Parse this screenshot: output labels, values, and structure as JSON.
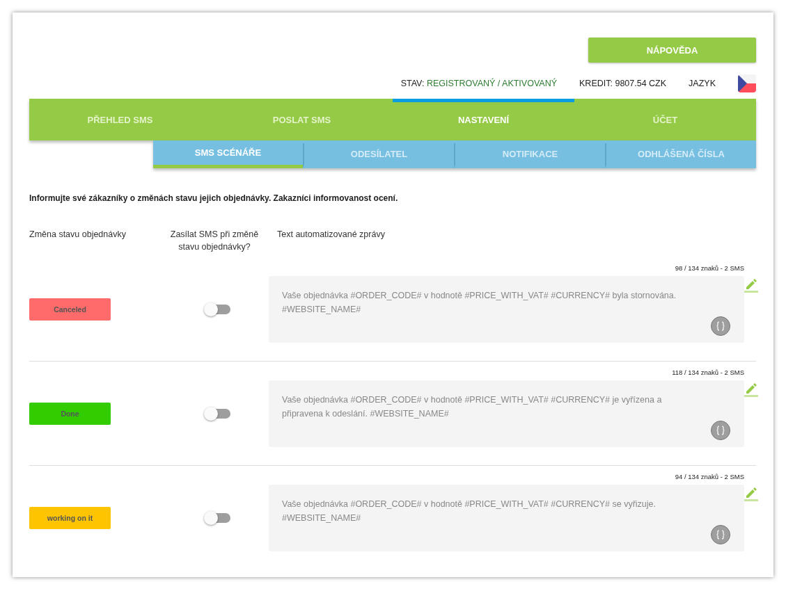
{
  "help_button": "NÁPOVĚDA",
  "status_bar": {
    "state_label": "STAV:",
    "state_value": "REGISTROVANÝ / AKTIVOVANÝ",
    "credit": "KREDIT: 9807.54 CZK",
    "language_label": "JAZYK"
  },
  "tabs": [
    {
      "label": "PŘEHLED SMS",
      "selected": false
    },
    {
      "label": "POSLAT SMS",
      "selected": false
    },
    {
      "label": "NASTAVENÍ",
      "selected": true
    },
    {
      "label": "ÚČET",
      "selected": false
    }
  ],
  "subtabs": [
    {
      "label": "SMS SCÉNÁŘE",
      "selected": true
    },
    {
      "label": "ODESÍLATEL",
      "selected": false
    },
    {
      "label": "NOTIFIKACE",
      "selected": false
    },
    {
      "label": "ODHLÁŠENÁ ČÍSLA",
      "selected": false
    }
  ],
  "intro": "Informujte své zákazníky o změnách stavu jejich objednávky. Zakazníci informovanost ocení.",
  "columns": [
    "Změna stavu objednávky",
    "Zasílat SMS při změně stavu objednávky?",
    "Text automatizované zprávy"
  ],
  "rows": [
    {
      "status": "Canceled",
      "color": "#ff6b6b",
      "on": false,
      "counter": "98 / 134 znaků - 2 SMS",
      "message": "Vaše objednávka #ORDER_CODE# v hodnotě #PRICE_WITH_VAT# #CURRENCY# byla stornována. #WEBSITE_NAME#"
    },
    {
      "status": "Done",
      "color": "#33cc00",
      "on": false,
      "counter": "118 / 134 znaků - 2 SMS",
      "message": "Vaše objednávka #ORDER_CODE# v hodnotě #PRICE_WITH_VAT# #CURRENCY# je vyřízena a připravena k odeslání. #WEBSITE_NAME#"
    },
    {
      "status": "working on it",
      "color": "#ffc400",
      "on": false,
      "counter": "94 / 134 znaků - 2 SMS",
      "message": "Vaše objednávka #ORDER_CODE# v hodnotě #PRICE_WITH_VAT# #CURRENCY# se vyřizuje. #WEBSITE_NAME#"
    }
  ]
}
